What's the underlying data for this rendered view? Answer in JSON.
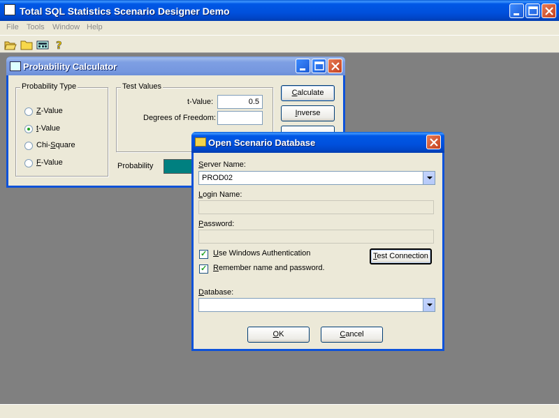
{
  "app": {
    "title": "Total SQL Statistics Scenario Designer Demo",
    "menu": [
      "File",
      "Tools",
      "Window",
      "Help"
    ],
    "toolbar_icons": [
      "open-folder-icon",
      "folder-icon",
      "calculator-icon",
      "help-icon"
    ],
    "colors": {
      "titlebar": "#0058e6",
      "face": "#ece9d8",
      "workspace": "#808080",
      "progress": "#008080"
    }
  },
  "calc": {
    "title": "Probability Calculator",
    "prob_type_label": "Probability Type",
    "options": [
      {
        "label": "Z-Value",
        "mnemonic": "Z",
        "rest": "-Value",
        "selected": false
      },
      {
        "label": "t-Value",
        "mnemonic": "t",
        "rest": "-Value",
        "selected": true
      },
      {
        "label": "Chi-Square",
        "mnemonic": "",
        "rest": "",
        "pre": "Chi-",
        "mn": "S",
        "post": "quare",
        "selected": false
      },
      {
        "label": "F-Value",
        "mnemonic": "F",
        "rest": "-Value",
        "selected": false
      }
    ],
    "test_values_label": "Test Values",
    "t_value_label": "t-Value:",
    "t_value": "0.5",
    "dof_label": "Degrees of Freedom:",
    "dof_value": "",
    "calculate_label": "Calculate",
    "inverse_label": "Inverse",
    "probability_label": "Probability"
  },
  "dialog": {
    "title": "Open Scenario Database",
    "server_label": "Server Name:",
    "server_value": "PROD02",
    "login_label": "Login Name:",
    "login_value": "",
    "password_label": "Password:",
    "password_value": "",
    "win_auth_label": "Use Windows Authentication",
    "win_auth_checked": true,
    "remember_label": "Remember name and password.",
    "remember_checked": true,
    "test_connection_label": "Test Connection",
    "database_label": "Database:",
    "database_value": "",
    "ok_label": "OK",
    "cancel_label": "Cancel"
  }
}
